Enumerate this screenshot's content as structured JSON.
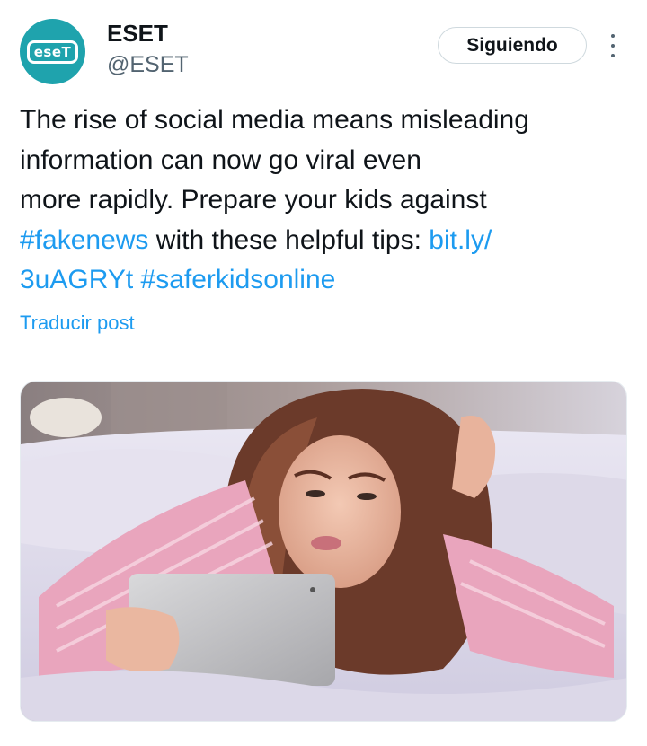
{
  "author": {
    "name": "ESET",
    "handle": "@ESET",
    "logo_text": "eseT"
  },
  "follow_button": {
    "label": "Siguiendo"
  },
  "tweet": {
    "line1": "The rise of social media means misleading",
    "line2": "information can now go viral even",
    "line3": "more rapidly. Prepare your kids against",
    "hashtag_fakenews": "#fakenews",
    "line4_mid": " with these helpful tips: ",
    "link_part1": "bit.ly/",
    "link_part2": "3uAGRYt",
    "hashtag_saferkids": "#saferkidsonline"
  },
  "translate_label": "Traducir post",
  "colors": {
    "avatar_bg": "#1fa3ad",
    "link": "#1d9bf0",
    "text": "#0f1419",
    "secondary": "#536471"
  },
  "icons": {
    "more": "vertical-ellipsis-icon"
  }
}
